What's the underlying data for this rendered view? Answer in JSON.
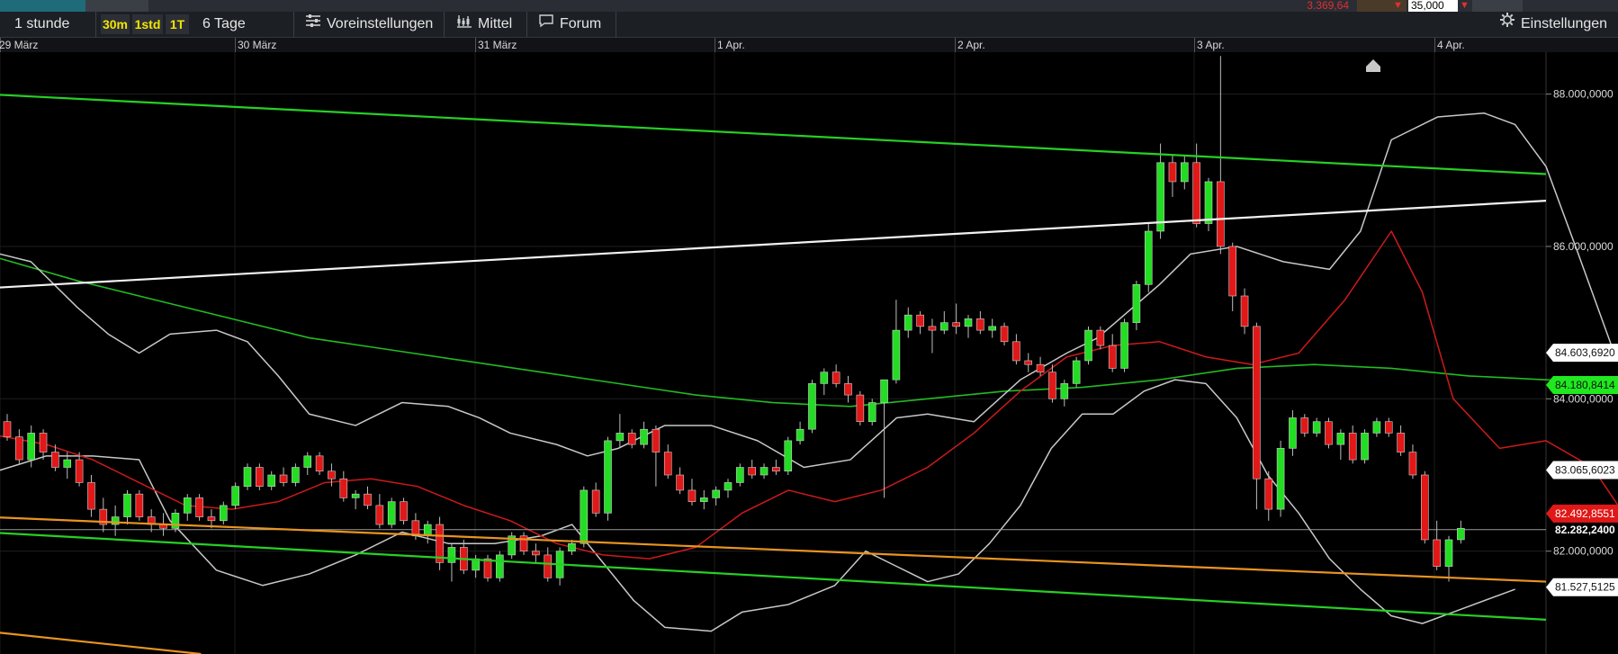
{
  "top_strip": {
    "price": "3.369,64",
    "quantity": "35,000",
    "accent_red": "#e03030"
  },
  "toolbar": {
    "period_label": "1 stunde",
    "intervals": [
      "30m",
      "1std",
      "1T"
    ],
    "range_label": "6 Tage",
    "presets_label": "Voreinstellungen",
    "indicator_label": "Mittel",
    "forum_label": "Forum",
    "settings_label": "Einstellungen",
    "icons": {
      "presets": "sliders-icon",
      "indicator": "indicator-chart-icon",
      "forum": "chat-bubble-icon",
      "settings": "gear-icon"
    }
  },
  "date_axis": [
    "29 März",
    "30 März",
    "31 März",
    "1 Apr.",
    "2 Apr.",
    "3 Apr.",
    "4 Apr."
  ],
  "chart_data": {
    "type": "candlestick",
    "y_ticks": [
      "88.000,0000",
      "86.000,0000",
      "84.000,0000",
      "82.000,0000"
    ],
    "ylim": [
      80.65,
      88.55
    ],
    "price_labels": [
      {
        "text": "84.603,6920",
        "value": 84.6037,
        "style": "white"
      },
      {
        "text": "84.180,8414",
        "value": 84.1808,
        "style": "green"
      },
      {
        "text": "83.065,6023",
        "value": 83.0656,
        "style": "white"
      },
      {
        "text": "82.492,8551",
        "value": 82.4929,
        "style": "red"
      },
      {
        "text": "82.282,2400",
        "value": 82.2822,
        "style": "current"
      },
      {
        "text": "81.527,5125",
        "value": 81.5275,
        "style": "white"
      }
    ],
    "current_price": 82.2822,
    "colors": {
      "up": "#22dd22",
      "down": "#e01818",
      "bollinger": "#c8c8c8",
      "ma_short": "#cc1a1a",
      "ma_long": "#22bb22",
      "trend_green": "#26d026",
      "trend_white": "#f2f2f2",
      "trend_orange": "#e89420"
    },
    "candles": [
      [
        83.7,
        83.8,
        83.45,
        83.5
      ],
      [
        83.5,
        83.6,
        83.15,
        83.2
      ],
      [
        83.2,
        83.65,
        83.1,
        83.55
      ],
      [
        83.55,
        83.6,
        83.2,
        83.3
      ],
      [
        83.3,
        83.4,
        83.05,
        83.1
      ],
      [
        83.1,
        83.3,
        82.95,
        83.2
      ],
      [
        83.2,
        83.3,
        82.85,
        82.9
      ],
      [
        82.9,
        83.0,
        82.45,
        82.55
      ],
      [
        82.55,
        82.7,
        82.25,
        82.35
      ],
      [
        82.35,
        82.6,
        82.2,
        82.45
      ],
      [
        82.45,
        82.8,
        82.35,
        82.75
      ],
      [
        82.75,
        82.8,
        82.4,
        82.45
      ],
      [
        82.45,
        82.55,
        82.25,
        82.35
      ],
      [
        82.35,
        82.5,
        82.2,
        82.3
      ],
      [
        82.3,
        82.55,
        82.25,
        82.5
      ],
      [
        82.5,
        82.75,
        82.4,
        82.7
      ],
      [
        82.7,
        82.75,
        82.4,
        82.45
      ],
      [
        82.45,
        82.55,
        82.3,
        82.4
      ],
      [
        82.4,
        82.65,
        82.35,
        82.6
      ],
      [
        82.6,
        82.9,
        82.55,
        82.85
      ],
      [
        82.85,
        83.15,
        82.8,
        83.1
      ],
      [
        83.1,
        83.15,
        82.8,
        82.85
      ],
      [
        82.85,
        83.05,
        82.8,
        83.0
      ],
      [
        83.0,
        83.1,
        82.85,
        82.9
      ],
      [
        82.9,
        83.15,
        82.85,
        83.1
      ],
      [
        83.1,
        83.3,
        83.0,
        83.25
      ],
      [
        83.25,
        83.3,
        83.0,
        83.05
      ],
      [
        83.05,
        83.15,
        82.85,
        82.95
      ],
      [
        82.95,
        83.05,
        82.65,
        82.7
      ],
      [
        82.7,
        82.8,
        82.55,
        82.75
      ],
      [
        82.75,
        82.85,
        82.55,
        82.6
      ],
      [
        82.6,
        82.75,
        82.3,
        82.35
      ],
      [
        82.35,
        82.7,
        82.3,
        82.65
      ],
      [
        82.65,
        82.7,
        82.35,
        82.4
      ],
      [
        82.4,
        82.5,
        82.15,
        82.2
      ],
      [
        82.2,
        82.4,
        82.1,
        82.35
      ],
      [
        82.35,
        82.45,
        81.75,
        81.85
      ],
      [
        81.85,
        82.1,
        81.6,
        82.05
      ],
      [
        82.05,
        82.15,
        81.7,
        81.75
      ],
      [
        81.75,
        81.95,
        81.65,
        81.9
      ],
      [
        81.9,
        81.95,
        81.6,
        81.65
      ],
      [
        81.65,
        82.0,
        81.6,
        81.95
      ],
      [
        81.95,
        82.25,
        81.9,
        82.2
      ],
      [
        82.2,
        82.25,
        81.95,
        82.0
      ],
      [
        82.0,
        82.1,
        81.85,
        81.95
      ],
      [
        81.95,
        82.05,
        81.6,
        81.65
      ],
      [
        81.65,
        82.05,
        81.55,
        82.0
      ],
      [
        82.0,
        82.15,
        81.95,
        82.1
      ],
      [
        82.1,
        82.85,
        82.05,
        82.8
      ],
      [
        82.8,
        82.9,
        82.45,
        82.5
      ],
      [
        82.5,
        83.5,
        82.4,
        83.45
      ],
      [
        83.45,
        83.8,
        83.35,
        83.55
      ],
      [
        83.55,
        83.6,
        83.35,
        83.4
      ],
      [
        83.4,
        83.7,
        83.35,
        83.6
      ],
      [
        83.6,
        83.65,
        82.85,
        83.3
      ],
      [
        83.3,
        83.4,
        82.95,
        83.0
      ],
      [
        83.0,
        83.1,
        82.75,
        82.8
      ],
      [
        82.8,
        82.95,
        82.6,
        82.65
      ],
      [
        82.65,
        82.8,
        82.55,
        82.7
      ],
      [
        82.7,
        82.85,
        82.6,
        82.8
      ],
      [
        82.8,
        82.95,
        82.7,
        82.9
      ],
      [
        82.9,
        83.15,
        82.85,
        83.1
      ],
      [
        83.1,
        83.2,
        82.95,
        83.0
      ],
      [
        83.0,
        83.15,
        82.95,
        83.1
      ],
      [
        83.1,
        83.2,
        83.0,
        83.05
      ],
      [
        83.05,
        83.5,
        83.0,
        83.45
      ],
      [
        83.45,
        83.7,
        83.4,
        83.6
      ],
      [
        83.6,
        84.25,
        83.55,
        84.2
      ],
      [
        84.2,
        84.4,
        84.05,
        84.35
      ],
      [
        84.35,
        84.45,
        84.15,
        84.2
      ],
      [
        84.2,
        84.3,
        83.95,
        84.05
      ],
      [
        84.05,
        84.1,
        83.65,
        83.7
      ],
      [
        83.7,
        84.0,
        83.65,
        83.95
      ],
      [
        83.95,
        84.25,
        82.7,
        84.25
      ],
      [
        84.25,
        85.3,
        84.2,
        84.9
      ],
      [
        84.9,
        85.2,
        84.8,
        85.1
      ],
      [
        85.1,
        85.15,
        84.85,
        84.95
      ],
      [
        84.95,
        85.05,
        84.6,
        84.9
      ],
      [
        84.9,
        85.15,
        84.85,
        85.0
      ],
      [
        85.0,
        85.25,
        84.85,
        84.95
      ],
      [
        84.95,
        85.1,
        84.8,
        85.05
      ],
      [
        85.05,
        85.15,
        84.85,
        84.9
      ],
      [
        84.9,
        85.05,
        84.8,
        84.95
      ],
      [
        84.95,
        85.0,
        84.7,
        84.75
      ],
      [
        84.75,
        84.85,
        84.45,
        84.5
      ],
      [
        84.5,
        84.6,
        84.35,
        84.45
      ],
      [
        84.45,
        84.55,
        84.3,
        84.35
      ],
      [
        84.35,
        84.45,
        83.95,
        84.0
      ],
      [
        84.0,
        84.25,
        83.9,
        84.2
      ],
      [
        84.2,
        84.55,
        84.15,
        84.5
      ],
      [
        84.5,
        84.95,
        84.45,
        84.9
      ],
      [
        84.9,
        84.95,
        84.65,
        84.7
      ],
      [
        84.7,
        84.85,
        84.35,
        84.4
      ],
      [
        84.4,
        85.05,
        84.35,
        85.0
      ],
      [
        85.0,
        85.55,
        84.9,
        85.5
      ],
      [
        85.5,
        86.3,
        85.4,
        86.2
      ],
      [
        86.2,
        87.35,
        86.1,
        87.1
      ],
      [
        87.1,
        87.2,
        86.65,
        86.85
      ],
      [
        86.85,
        87.2,
        86.75,
        87.1
      ],
      [
        87.1,
        87.35,
        86.25,
        86.3
      ],
      [
        86.3,
        86.9,
        86.2,
        86.85
      ],
      [
        86.85,
        88.5,
        85.9,
        86.0
      ],
      [
        86.0,
        86.05,
        85.15,
        85.35
      ],
      [
        85.35,
        85.45,
        84.85,
        84.95
      ],
      [
        84.95,
        85.0,
        82.55,
        82.95
      ],
      [
        82.95,
        83.05,
        82.4,
        82.55
      ],
      [
        82.55,
        83.45,
        82.45,
        83.35
      ],
      [
        83.35,
        83.85,
        83.25,
        83.75
      ],
      [
        83.75,
        83.8,
        83.5,
        83.55
      ],
      [
        83.55,
        83.75,
        83.5,
        83.7
      ],
      [
        83.7,
        83.75,
        83.35,
        83.4
      ],
      [
        83.4,
        83.6,
        83.2,
        83.55
      ],
      [
        83.55,
        83.65,
        83.15,
        83.2
      ],
      [
        83.2,
        83.6,
        83.15,
        83.55
      ],
      [
        83.55,
        83.75,
        83.5,
        83.7
      ],
      [
        83.7,
        83.75,
        83.5,
        83.55
      ],
      [
        83.55,
        83.65,
        83.25,
        83.3
      ],
      [
        83.3,
        83.4,
        82.95,
        83.0
      ],
      [
        83.0,
        83.05,
        82.1,
        82.15
      ],
      [
        82.15,
        82.4,
        81.75,
        81.8
      ],
      [
        81.8,
        82.2,
        81.6,
        82.15
      ],
      [
        82.15,
        82.4,
        82.1,
        82.3
      ]
    ],
    "bollinger_upper": [
      [
        -0.01,
        85.95
      ],
      [
        0.02,
        85.8
      ],
      [
        0.05,
        85.2
      ],
      [
        0.07,
        84.85
      ],
      [
        0.09,
        84.6
      ],
      [
        0.11,
        84.85
      ],
      [
        0.14,
        84.9
      ],
      [
        0.16,
        84.75
      ],
      [
        0.18,
        84.3
      ],
      [
        0.2,
        83.8
      ],
      [
        0.23,
        83.65
      ],
      [
        0.26,
        83.95
      ],
      [
        0.29,
        83.9
      ],
      [
        0.31,
        83.75
      ],
      [
        0.33,
        83.55
      ],
      [
        0.36,
        83.4
      ],
      [
        0.38,
        83.25
      ],
      [
        0.4,
        83.35
      ],
      [
        0.43,
        83.65
      ],
      [
        0.46,
        83.65
      ],
      [
        0.49,
        83.45
      ],
      [
        0.52,
        83.1
      ],
      [
        0.55,
        83.2
      ],
      [
        0.58,
        83.75
      ],
      [
        0.6,
        83.8
      ],
      [
        0.63,
        83.7
      ],
      [
        0.66,
        84.25
      ],
      [
        0.69,
        84.6
      ],
      [
        0.71,
        84.8
      ],
      [
        0.75,
        85.5
      ],
      [
        0.77,
        85.9
      ],
      [
        0.8,
        86.0
      ],
      [
        0.83,
        85.8
      ],
      [
        0.86,
        85.7
      ],
      [
        0.88,
        86.2
      ],
      [
        0.9,
        87.4
      ],
      [
        0.93,
        87.7
      ],
      [
        0.96,
        87.75
      ],
      [
        0.98,
        87.6
      ],
      [
        1.0,
        87.05
      ],
      [
        1.02,
        85.95
      ],
      [
        1.045,
        84.55
      ]
    ],
    "bollinger_lower": [
      [
        -0.01,
        83.0
      ],
      [
        0.03,
        83.25
      ],
      [
        0.06,
        83.25
      ],
      [
        0.09,
        83.2
      ],
      [
        0.11,
        82.4
      ],
      [
        0.14,
        81.75
      ],
      [
        0.17,
        81.55
      ],
      [
        0.2,
        81.7
      ],
      [
        0.23,
        81.95
      ],
      [
        0.26,
        82.25
      ],
      [
        0.29,
        82.1
      ],
      [
        0.32,
        82.1
      ],
      [
        0.35,
        82.2
      ],
      [
        0.37,
        82.35
      ],
      [
        0.39,
        81.85
      ],
      [
        0.41,
        81.35
      ],
      [
        0.43,
        81.0
      ],
      [
        0.46,
        80.95
      ],
      [
        0.48,
        81.2
      ],
      [
        0.51,
        81.3
      ],
      [
        0.54,
        81.55
      ],
      [
        0.56,
        82.0
      ],
      [
        0.58,
        81.8
      ],
      [
        0.6,
        81.6
      ],
      [
        0.62,
        81.7
      ],
      [
        0.64,
        82.1
      ],
      [
        0.66,
        82.6
      ],
      [
        0.68,
        83.35
      ],
      [
        0.7,
        83.8
      ],
      [
        0.72,
        83.8
      ],
      [
        0.74,
        84.1
      ],
      [
        0.76,
        84.25
      ],
      [
        0.78,
        84.2
      ],
      [
        0.8,
        83.75
      ],
      [
        0.82,
        83.0
      ],
      [
        0.84,
        82.5
      ],
      [
        0.86,
        81.9
      ],
      [
        0.88,
        81.5
      ],
      [
        0.9,
        81.15
      ],
      [
        0.92,
        81.05
      ],
      [
        0.94,
        81.2
      ],
      [
        0.98,
        81.5
      ]
    ],
    "ma_short": [
      [
        -0.01,
        83.55
      ],
      [
        0.03,
        83.4
      ],
      [
        0.06,
        83.2
      ],
      [
        0.09,
        82.9
      ],
      [
        0.12,
        82.6
      ],
      [
        0.15,
        82.55
      ],
      [
        0.18,
        82.65
      ],
      [
        0.21,
        82.9
      ],
      [
        0.24,
        82.95
      ],
      [
        0.27,
        82.85
      ],
      [
        0.3,
        82.6
      ],
      [
        0.33,
        82.4
      ],
      [
        0.36,
        82.1
      ],
      [
        0.39,
        81.95
      ],
      [
        0.42,
        81.9
      ],
      [
        0.45,
        82.05
      ],
      [
        0.48,
        82.5
      ],
      [
        0.51,
        82.8
      ],
      [
        0.54,
        82.65
      ],
      [
        0.57,
        82.8
      ],
      [
        0.6,
        83.1
      ],
      [
        0.63,
        83.55
      ],
      [
        0.66,
        84.1
      ],
      [
        0.69,
        84.55
      ],
      [
        0.72,
        84.7
      ],
      [
        0.75,
        84.75
      ],
      [
        0.78,
        84.55
      ],
      [
        0.81,
        84.45
      ],
      [
        0.84,
        84.6
      ],
      [
        0.87,
        85.3
      ],
      [
        0.9,
        86.2
      ],
      [
        0.92,
        85.4
      ],
      [
        0.94,
        84.0
      ],
      [
        0.97,
        83.35
      ],
      [
        1.0,
        83.45
      ],
      [
        1.03,
        83.1
      ],
      [
        1.05,
        82.5
      ]
    ],
    "ma_long": [
      [
        -0.01,
        85.9
      ],
      [
        0.05,
        85.55
      ],
      [
        0.1,
        85.3
      ],
      [
        0.15,
        85.05
      ],
      [
        0.2,
        84.8
      ],
      [
        0.25,
        84.65
      ],
      [
        0.3,
        84.5
      ],
      [
        0.35,
        84.35
      ],
      [
        0.4,
        84.2
      ],
      [
        0.45,
        84.05
      ],
      [
        0.5,
        83.95
      ],
      [
        0.55,
        83.9
      ],
      [
        0.6,
        84.0
      ],
      [
        0.65,
        84.1
      ],
      [
        0.7,
        84.15
      ],
      [
        0.75,
        84.25
      ],
      [
        0.8,
        84.4
      ],
      [
        0.85,
        84.45
      ],
      [
        0.9,
        84.4
      ],
      [
        0.95,
        84.3
      ],
      [
        1.0,
        84.25
      ],
      [
        1.045,
        84.18
      ]
    ],
    "trendlines": [
      {
        "name": "green-upper",
        "from": [
          -0.01,
          88.0
        ],
        "to": [
          1.0,
          86.95
        ]
      },
      {
        "name": "white-mid",
        "from": [
          -0.01,
          85.45
        ],
        "to": [
          1.0,
          86.6
        ]
      },
      {
        "name": "orange-support",
        "from": [
          -0.01,
          82.45
        ],
        "to": [
          1.0,
          81.6
        ]
      },
      {
        "name": "green-lower",
        "from": [
          -0.01,
          82.25
        ],
        "to": [
          1.0,
          81.1
        ]
      },
      {
        "name": "orange-low",
        "from": [
          -0.01,
          80.95
        ],
        "to": [
          0.13,
          80.65
        ]
      }
    ]
  }
}
